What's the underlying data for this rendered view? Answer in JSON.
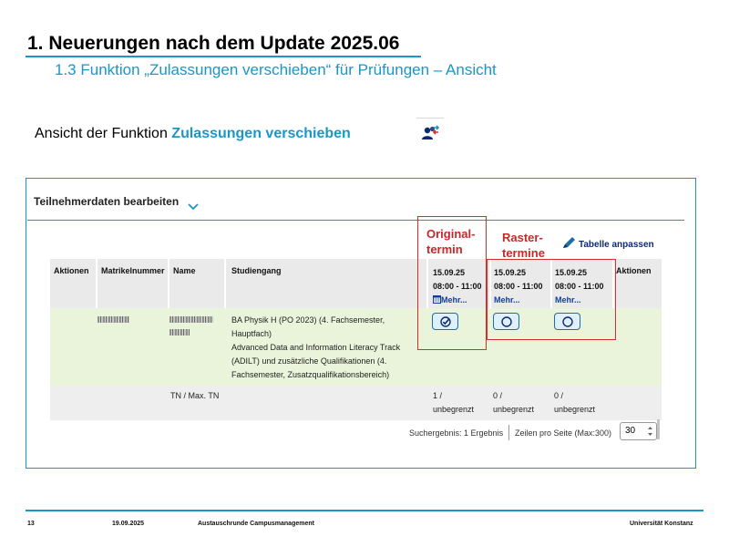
{
  "slide": {
    "title": "1. Neuerungen nach dem Update 2025.06",
    "subtitle": "1.3 Funktion „Zulassungen verschieben“ für Prüfungen – Ansicht",
    "intro_prefix": "Ansicht der Funktion ",
    "intro_highlight": "Zulassungen verschieben",
    "accent_color": "#1a96c8",
    "shift_icon": "user-shift-icon"
  },
  "panel": {
    "header": "Teilnehmerdaten bearbeiten",
    "adjust_table_label": "Tabelle anpassen",
    "annotations": {
      "original_line1": "Original-",
      "original_line2": "termin",
      "raster_line1": "Raster-",
      "raster_line2": "termine",
      "color": "#c62828"
    },
    "table": {
      "columns": {
        "actions": "Aktionen",
        "matrikel": "Matrikelnummer",
        "name": "Name",
        "program": "Studiengang",
        "actions_right": "Aktionen"
      },
      "date_columns": [
        {
          "date": "15.09.25",
          "time": "08:00 - 11:00",
          "more": "Mehr...",
          "icon": "calendar-icon",
          "selected": true
        },
        {
          "date": "15.09.25",
          "time": "08:00 - 11:00",
          "more": "Mehr...",
          "selected": false
        },
        {
          "date": "15.09.25",
          "time": "08:00 - 11:00",
          "more": "Mehr...",
          "selected": false
        }
      ],
      "row": {
        "program_lines": [
          "BA Physik H (PO 2023) (4. Fachsemester,",
          "Hauptfach)",
          "Advanced Data and Information Literacy Track",
          "(ADILT) und zusätzliche Qualifikationen (4.",
          "Fachsemester, Zusatzqualifikationsbereich)"
        ]
      },
      "footer": {
        "label": "TN / Max. TN",
        "counts": [
          {
            "line1": "1 /",
            "line2": "unbegrenzt"
          },
          {
            "line1": "0 /",
            "line2": "unbegrenzt"
          },
          {
            "line1": "0 /",
            "line2": "unbegrenzt"
          }
        ]
      }
    },
    "pagination": {
      "result_info": "Suchergebnis: 1 Ergebnis",
      "per_page_label": "Zeilen pro Seite (Max:300)",
      "per_page_value": "30"
    }
  },
  "footer": {
    "page": "13",
    "date": "19.09.2025",
    "event": "Austauschrunde Campusmanagement",
    "org": "Universität Konstanz"
  }
}
